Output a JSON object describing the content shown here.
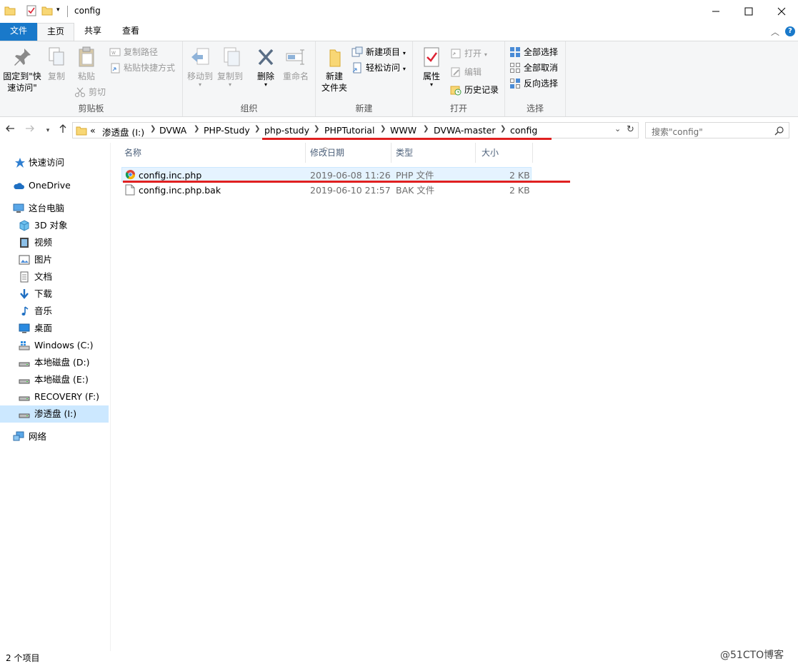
{
  "window": {
    "title": "config",
    "minimize_icon": "minimize-icon",
    "maximize_icon": "maximize-icon",
    "close_icon": "close-icon"
  },
  "ribbon_tabs": {
    "file": "文件",
    "home": "主页",
    "share": "共享",
    "view": "查看"
  },
  "ribbon": {
    "clipboard": {
      "label": "剪贴板",
      "pin_line1": "固定到\"快",
      "pin_line2": "速访问\"",
      "copy": "复制",
      "paste": "粘贴",
      "copy_path": "复制路径",
      "paste_shortcut": "粘贴快捷方式",
      "cut": "剪切"
    },
    "organize": {
      "label": "组织",
      "move_to": "移动到",
      "copy_to": "复制到",
      "delete": "删除",
      "rename": "重命名"
    },
    "new": {
      "label": "新建",
      "new_folder_line1": "新建",
      "new_folder_line2": "文件夹",
      "new_item": "新建项目",
      "easy_access": "轻松访问"
    },
    "open": {
      "label": "打开",
      "properties": "属性",
      "open": "打开",
      "edit": "编辑",
      "history": "历史记录"
    },
    "select": {
      "label": "选择",
      "select_all": "全部选择",
      "select_none": "全部取消",
      "invert": "反向选择"
    }
  },
  "address": {
    "overflow": "«",
    "crumbs": [
      "渗透盘 (I:)",
      "DVWA",
      "PHP-Study",
      "php-study",
      "PHPTutorial",
      "WWW",
      "DVWA-master",
      "config"
    ],
    "search_placeholder": "搜索\"config\""
  },
  "navpane": {
    "quick_access": "快速访问",
    "onedrive": "OneDrive",
    "this_pc": "这台电脑",
    "objects3d": "3D 对象",
    "videos": "视频",
    "pictures": "图片",
    "documents": "文档",
    "downloads": "下载",
    "music": "音乐",
    "desktop": "桌面",
    "drive_c": "Windows (C:)",
    "drive_d": "本地磁盘 (D:)",
    "drive_e": "本地磁盘 (E:)",
    "drive_f": "RECOVERY (F:)",
    "drive_i": "渗透盘 (I:)",
    "network": "网络"
  },
  "columns": {
    "name": "名称",
    "modified": "修改日期",
    "type": "类型",
    "size": "大小"
  },
  "files": [
    {
      "name": "config.inc.php",
      "modified": "2019-06-08 11:26",
      "type": "PHP 文件",
      "size": "2 KB"
    },
    {
      "name": "config.inc.php.bak",
      "modified": "2019-06-10 21:57",
      "type": "BAK 文件",
      "size": "2 KB"
    }
  ],
  "status": {
    "count": "2 个项目"
  },
  "watermark": "@51CTO博客",
  "colors": {
    "accent": "#1979ca",
    "annotation": "#e02020",
    "selection": "#cce8ff"
  }
}
